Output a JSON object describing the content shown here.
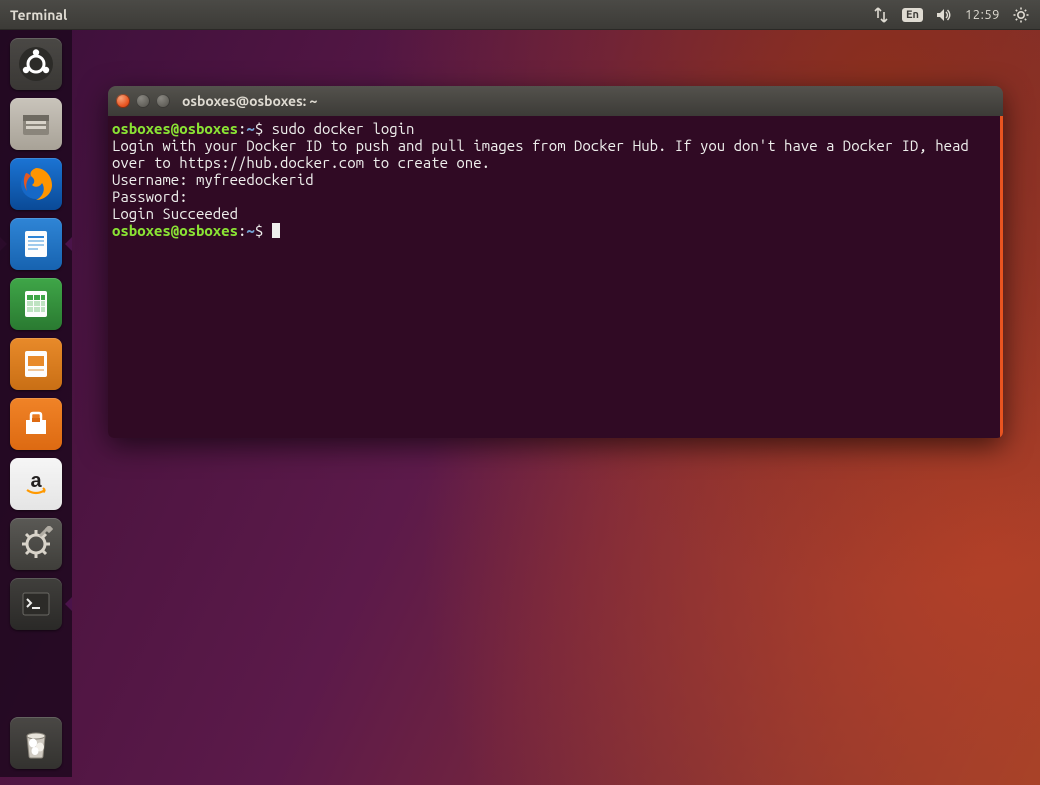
{
  "top_panel": {
    "title": "Terminal",
    "lang": "En",
    "time": "12:59"
  },
  "terminal": {
    "title": "osboxes@osboxes: ~",
    "prompt": {
      "user_host": "osboxes@osboxes",
      "colon": ":",
      "path": "~",
      "dollar": "$"
    },
    "lines": {
      "cmd1": "sudo docker login",
      "out1": "Login with your Docker ID to push and pull images from Docker Hub. If you don't have a Docker ID, head over to https://hub.docker.com to create one.",
      "user_label": "Username: ",
      "user_value": "myfreedockerid",
      "pass_label": "Password: ",
      "succ": "Login Succeeded"
    }
  },
  "launcher": {
    "items": [
      {
        "name": "dash",
        "label": "Ubuntu Dash"
      },
      {
        "name": "files",
        "label": "Files"
      },
      {
        "name": "firefox",
        "label": "Firefox"
      },
      {
        "name": "writer",
        "label": "LibreOffice Writer"
      },
      {
        "name": "calc",
        "label": "LibreOffice Calc"
      },
      {
        "name": "impress",
        "label": "LibreOffice Impress"
      },
      {
        "name": "software",
        "label": "Ubuntu Software"
      },
      {
        "name": "amazon",
        "label": "Amazon"
      },
      {
        "name": "settings",
        "label": "System Settings"
      },
      {
        "name": "terminal",
        "label": "Terminal"
      }
    ],
    "trash": "Trash"
  }
}
